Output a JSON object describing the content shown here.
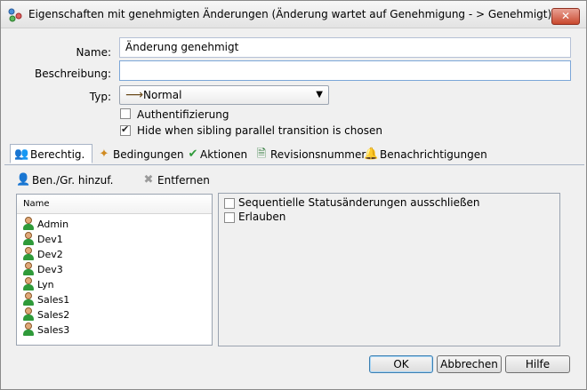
{
  "window": {
    "title": "Eigenschaften mit genehmigten Änderungen (Änderung wartet auf Genehmigung - > Genehmigt)",
    "close_symbol": "✕"
  },
  "form": {
    "name_label": "Name:",
    "name_value": "Änderung genehmigt",
    "description_label": "Beschreibung:",
    "description_value": "",
    "type_label": "Typ:",
    "type_value": "Normal",
    "type_icon": "arrow-right-icon",
    "auth_label": "Authentifizierung",
    "auth_checked": false,
    "hide_label": "Hide when sibling parallel transition is chosen",
    "hide_checked": true
  },
  "tabs": [
    {
      "label": "Berechtig.",
      "icon": "users-icon",
      "active": true
    },
    {
      "label": "Bedingungen",
      "icon": "conditions-icon",
      "active": false
    },
    {
      "label": "Aktionen",
      "icon": "actions-check-icon",
      "active": false
    },
    {
      "label": "Revisionsnummer",
      "icon": "revision-doc-icon",
      "active": false
    },
    {
      "label": "Benachrichtigungen",
      "icon": "bell-icon",
      "active": false
    }
  ],
  "toolbar": {
    "add_label": "Ben./Gr. hinzuf.",
    "remove_label": "Entfernen"
  },
  "user_list": {
    "header": "Name",
    "items": [
      "Admin",
      "Dev1",
      "Dev2",
      "Dev3",
      "Lyn",
      "Sales1",
      "Sales2",
      "Sales3"
    ]
  },
  "options": {
    "exclude_sequential_label": "Sequentielle Statusänderungen ausschließen",
    "exclude_sequential_checked": false,
    "allow_label": "Erlauben",
    "allow_checked": false
  },
  "buttons": {
    "ok": "OK",
    "cancel": "Abbrechen",
    "help": "Hilfe"
  },
  "colors": {
    "close_button": "#c9492e",
    "field_border": "#b5c1d6",
    "user_body": "#2f9a3a"
  }
}
